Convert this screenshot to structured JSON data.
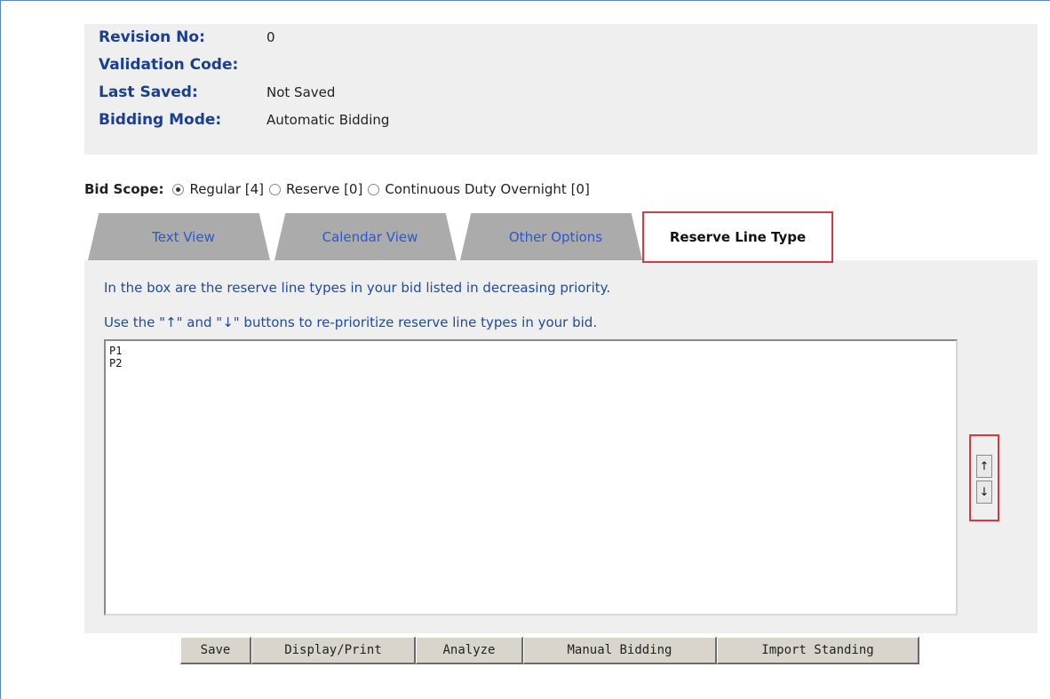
{
  "info": {
    "revision": {
      "label": "Revision No:",
      "value": "0"
    },
    "validation": {
      "label": "Validation Code:",
      "value": ""
    },
    "last_saved": {
      "label": "Last Saved:",
      "value": "Not Saved"
    },
    "bidding_mode": {
      "label": "Bidding Mode:",
      "value": "Automatic Bidding"
    }
  },
  "scope": {
    "label": "Bid Scope:",
    "options": [
      {
        "label": "Regular [4]",
        "checked": true
      },
      {
        "label": "Reserve [0]",
        "checked": false
      },
      {
        "label": "Continuous Duty Overnight [0]",
        "checked": false
      }
    ]
  },
  "tabs": [
    {
      "label": "Text View"
    },
    {
      "label": "Calendar View"
    },
    {
      "label": "Other Options"
    },
    {
      "label": "Reserve Line Type",
      "active": true
    }
  ],
  "panel": {
    "instruction1": "In the box are the reserve line types in your bid listed in decreasing priority.",
    "instruction2": "Use the \"↑\" and \"↓\" buttons to re-prioritize reserve line types in your bid.",
    "items": [
      "P1",
      "P2"
    ],
    "up_label": "↑",
    "down_label": "↓"
  },
  "actions": {
    "save": "Save",
    "display_print": "Display/Print",
    "analyze": "Analyze",
    "manual_bidding": "Manual Bidding",
    "import_standing": "Import Standing"
  },
  "colors": {
    "label_blue": "#1a3f8f",
    "tab_blue": "#2e57c9",
    "highlight_red": "#d63a3a",
    "panel_gray": "#efefef"
  }
}
